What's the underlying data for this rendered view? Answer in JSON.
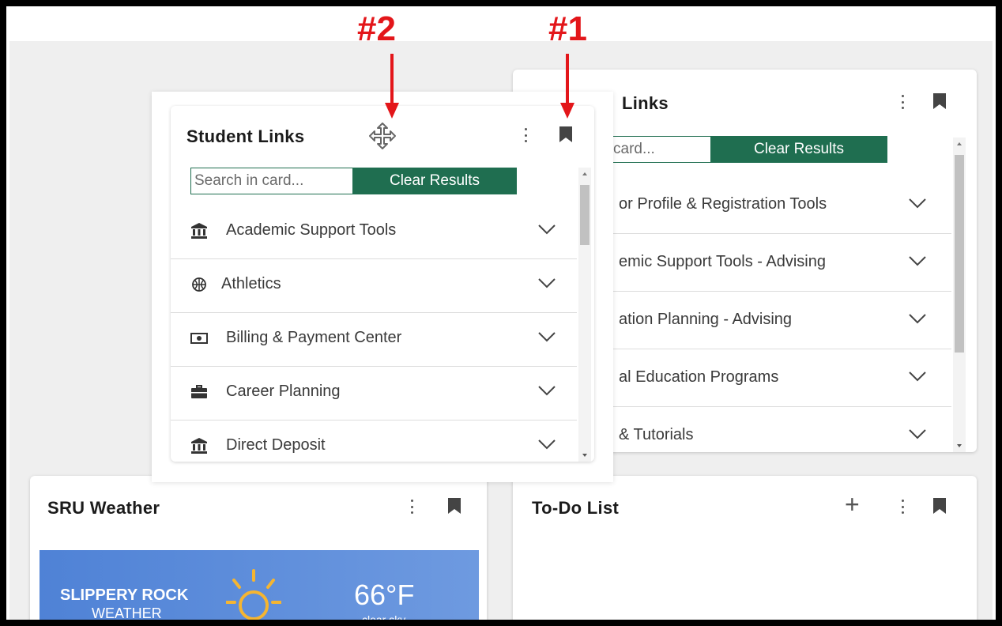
{
  "annotations": {
    "label_2": "#2",
    "label_1": "#1"
  },
  "back_card": {
    "title": "Links",
    "search_placeholder": "card...",
    "clear_label": "Clear Results",
    "items": [
      "or Profile & Registration Tools",
      "emic Support Tools - Advising",
      "ation Planning - Advising",
      "al Education Programs",
      "& Tutorials"
    ]
  },
  "student_links": {
    "title": "Student Links",
    "search_placeholder": "Search in card...",
    "clear_label": "Clear Results",
    "items": [
      {
        "label": "Academic Support Tools",
        "icon": "bank-icon"
      },
      {
        "label": "Athletics",
        "icon": "basketball-icon"
      },
      {
        "label": "Billing & Payment Center",
        "icon": "money-icon"
      },
      {
        "label": "Career Planning",
        "icon": "briefcase-icon"
      },
      {
        "label": "Direct Deposit",
        "icon": "bank-icon"
      }
    ]
  },
  "weather_card": {
    "title": "SRU Weather",
    "location_line1": "SLIPPERY ROCK",
    "location_line2": "WEATHER",
    "temperature": "66°F",
    "condition": "clear sky"
  },
  "todo_card": {
    "title": "To-Do List",
    "add_symbol": "+"
  },
  "colors": {
    "accent_green": "#1f6e50",
    "annotation_red": "#e3161a",
    "weather_blue": "#5a8ad8"
  }
}
